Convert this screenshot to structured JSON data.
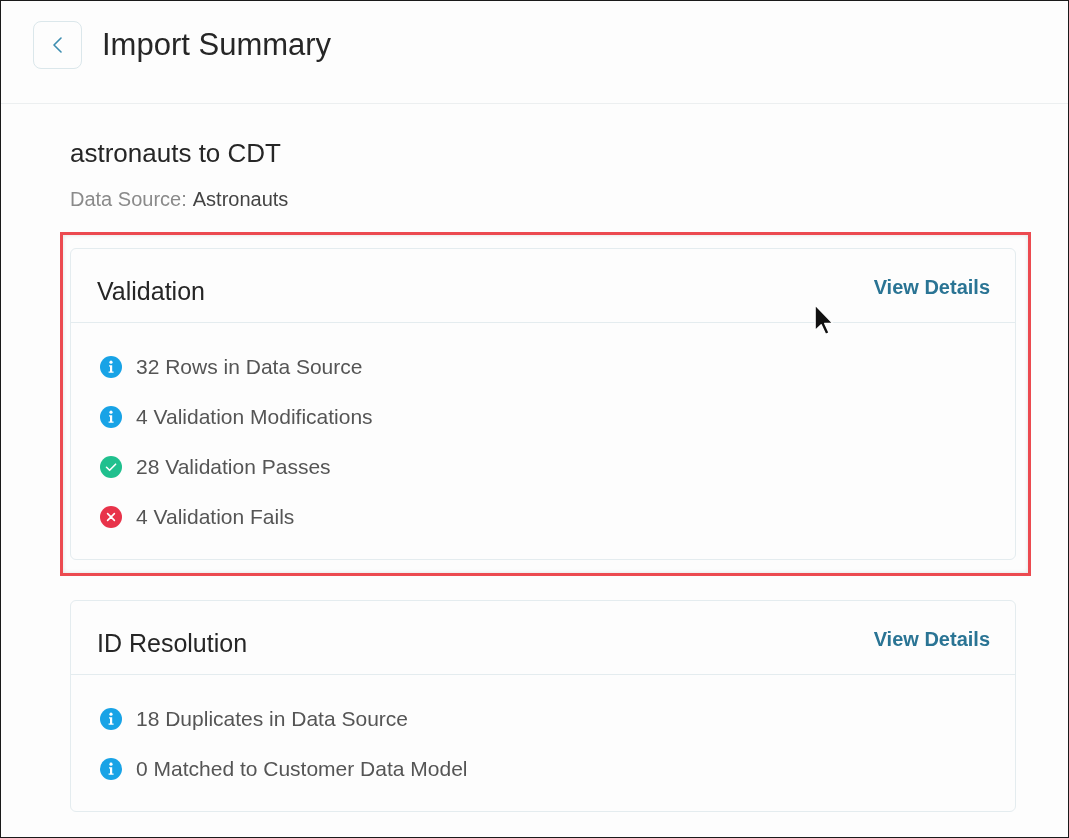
{
  "header": {
    "title": "Import Summary"
  },
  "import": {
    "name": "astronauts to CDT",
    "data_source": {
      "label": "Data Source:",
      "value": "Astronauts"
    }
  },
  "sections": [
    {
      "title": "Validation",
      "highlighted": true,
      "link": "View Details",
      "items": [
        {
          "kind": "info",
          "text": "32 Rows in Data Source"
        },
        {
          "kind": "info",
          "text": "4 Validation Modifications"
        },
        {
          "kind": "pass",
          "text": "28 Validation Passes"
        },
        {
          "kind": "fail",
          "text": "4 Validation Fails"
        }
      ]
    },
    {
      "title": "ID Resolution",
      "highlighted": false,
      "link": "View Details",
      "items": [
        {
          "kind": "info",
          "text": "18 Duplicates in Data Source"
        },
        {
          "kind": "info",
          "text": "0 Matched to Customer Data Model"
        }
      ]
    }
  ]
}
